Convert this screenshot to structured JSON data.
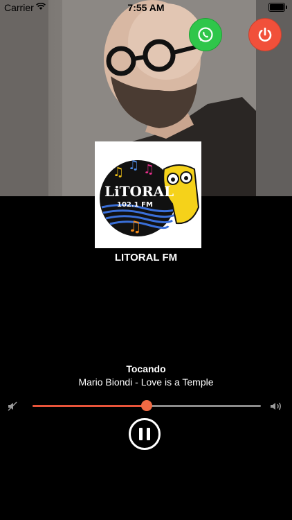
{
  "status_bar": {
    "carrier": "Carrier",
    "time": "7:55 AM"
  },
  "header": {
    "artwork": "artist-photo"
  },
  "actions": {
    "whatsapp_icon": "whatsapp-icon",
    "power_icon": "power-icon"
  },
  "station": {
    "logo_text": "LiTORAL",
    "logo_freq": "102.1 FM",
    "name": "LITORAL FM"
  },
  "now_playing": {
    "label": "Tocando",
    "track": "Mario Biondi - Love is a Temple"
  },
  "volume": {
    "level": 0.5
  },
  "controls": {
    "state": "playing",
    "button_icon": "pause-icon"
  },
  "colors": {
    "whatsapp": "#2fc64a",
    "power": "#f1503a",
    "slider_accent": "#e8543a",
    "background": "#000000"
  }
}
